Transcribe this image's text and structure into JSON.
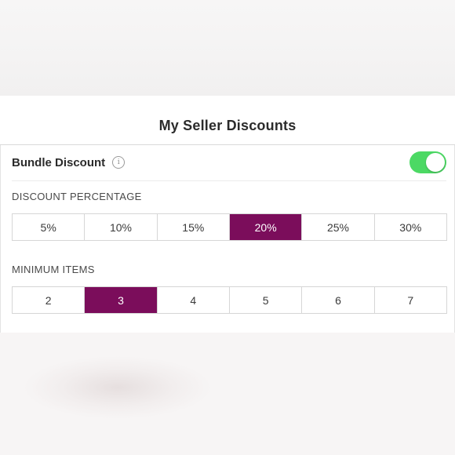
{
  "page": {
    "title": "My Seller Discounts"
  },
  "bundle": {
    "label": "Bundle Discount",
    "info_icon": "info-icon",
    "toggle_on": true
  },
  "discount": {
    "label": "DISCOUNT PERCENTAGE",
    "options": [
      "5%",
      "10%",
      "15%",
      "20%",
      "25%",
      "30%"
    ],
    "selected": "20%"
  },
  "minimum": {
    "label": "MINIMUM ITEMS",
    "options": [
      "2",
      "3",
      "4",
      "5",
      "6",
      "7"
    ],
    "selected": "3"
  },
  "colors": {
    "accent": "#7b0d5b",
    "toggle_on": "#4cd964"
  }
}
